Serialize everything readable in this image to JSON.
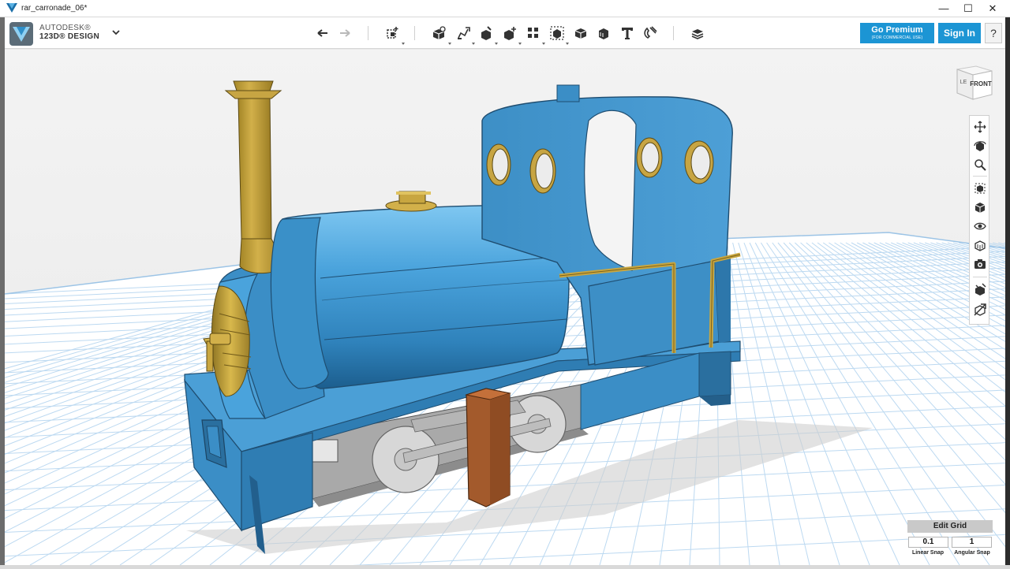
{
  "window": {
    "title": "rar_carronade_06*",
    "minimize": "—",
    "maximize": "☐",
    "close": "✕"
  },
  "brand": {
    "line1": "AUTODESK®",
    "line2": "123D® DESIGN"
  },
  "toolbar": {
    "undo_icon": "undo-icon",
    "redo_icon": "redo-icon",
    "tools": [
      "transform-icon",
      "primitives-icon",
      "sketch-icon",
      "construct-icon",
      "modify-icon",
      "pattern-icon",
      "grouping-icon",
      "combine-icon",
      "measure-icon",
      "text-icon",
      "snap-icon",
      "material-icon"
    ]
  },
  "account": {
    "premium_label": "Go Premium",
    "premium_sub": "(FOR COMMERCIAL USE)",
    "sign_in": "Sign In",
    "help": "?"
  },
  "view_cube": {
    "front": "FRONT",
    "left": "LE"
  },
  "nav_bar": {
    "items": [
      "pan-icon",
      "orbit-icon",
      "zoom-icon",
      "fit-icon",
      "view-icon",
      "visibility-icon",
      "material-view-icon",
      "screenshot-icon",
      "snap-to-icon",
      "analyze-icon"
    ]
  },
  "grid": {
    "edit_label": "Edit Grid",
    "linear_value": "0.1",
    "angular_value": "1",
    "linear_label": "Linear Snap",
    "angular_label": "Angular Snap"
  },
  "colors": {
    "accent": "#1c95d4",
    "body_blue": "#3b8ec6",
    "brass": "#c8a640",
    "buffer": "#a35a2c",
    "grid_line": "#b3d3ef"
  }
}
